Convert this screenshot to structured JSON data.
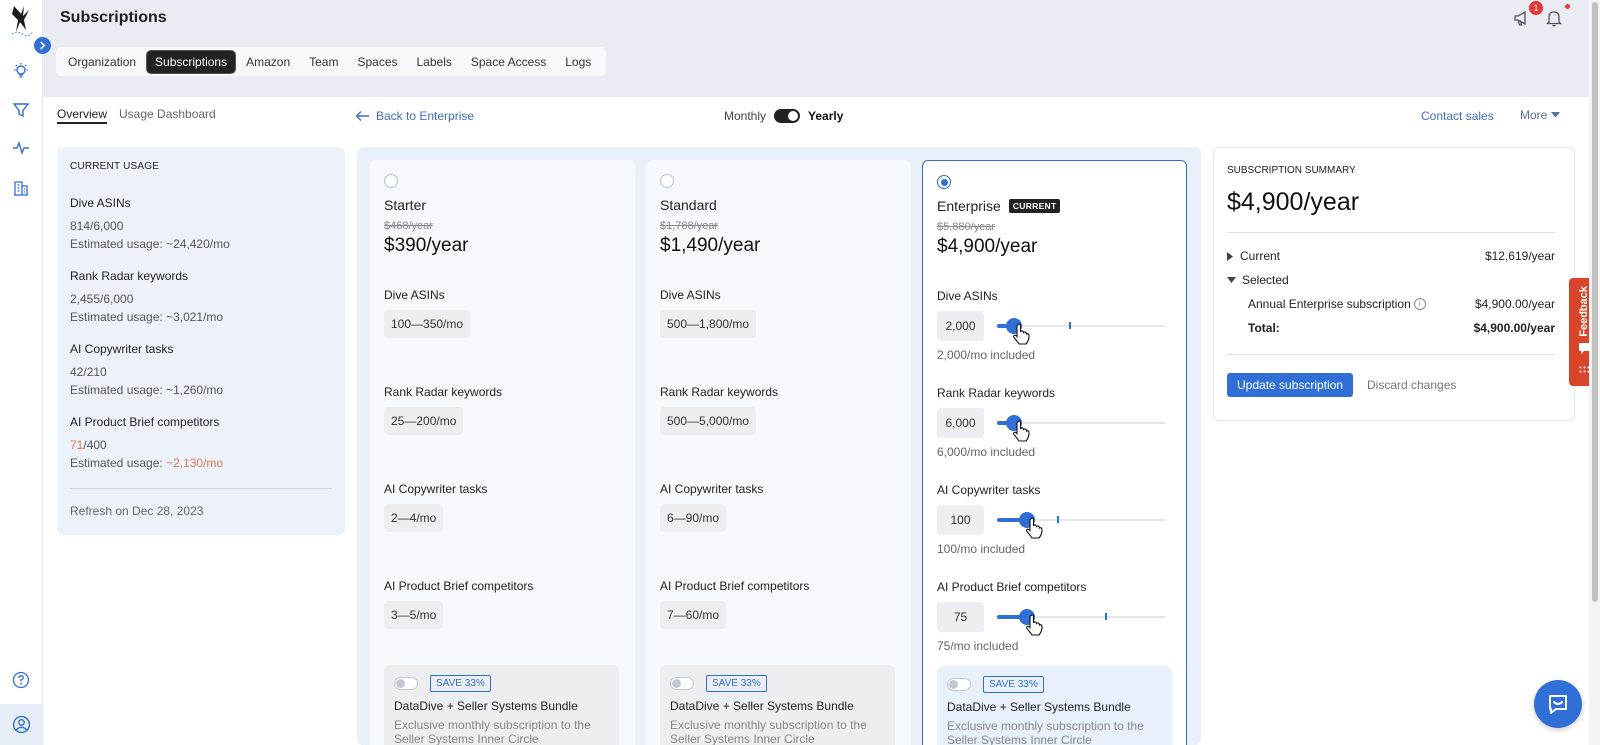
{
  "header": {
    "title": "Subscriptions",
    "notification_count": "1",
    "tabs": [
      "Organization",
      "Subscriptions",
      "Amazon",
      "Team",
      "Spaces",
      "Labels",
      "Space Access",
      "Logs"
    ]
  },
  "subnav": {
    "overview": "Overview",
    "usage_dashboard": "Usage Dashboard",
    "back": "Back to Enterprise",
    "monthly": "Monthly",
    "yearly": "Yearly",
    "contact_sales": "Contact sales",
    "more": "More"
  },
  "usage": {
    "heading": "CURRENT USAGE",
    "items": [
      {
        "title": "Dive ASINs",
        "used": "814",
        "limit": "/6,000",
        "estimate_prefix": "Estimated usage: ",
        "estimate": "~24,420/mo"
      },
      {
        "title": "Rank Radar keywords",
        "used": "2,455",
        "limit": "/6,000",
        "estimate_prefix": "Estimated usage: ",
        "estimate": "~3,021/mo"
      },
      {
        "title": "AI Copywriter tasks",
        "used": "42",
        "limit": "/210",
        "estimate_prefix": "Estimated usage: ",
        "estimate": "~1,260/mo"
      },
      {
        "title": "AI Product Brief competitors",
        "used": "71",
        "limit": "/400",
        "estimate_prefix": "Estimated usage: ",
        "estimate": "~2,130/mo"
      }
    ],
    "refresh": "Refresh on Dec 28, 2023"
  },
  "plans": [
    {
      "name": "Starter",
      "old_price": "$468/year",
      "price": "$390/year",
      "features": [
        {
          "label": "Dive ASINs",
          "range": "100—350/mo"
        },
        {
          "label": "Rank Radar keywords",
          "range": "25—200/mo"
        },
        {
          "label": "AI Copywriter tasks",
          "range": "2—4/mo"
        },
        {
          "label": "AI Product Brief competitors",
          "range": "3—5/mo"
        }
      ]
    },
    {
      "name": "Standard",
      "old_price": "$1,788/year",
      "price": "$1,490/year",
      "features": [
        {
          "label": "Dive ASINs",
          "range": "500—1,800/mo"
        },
        {
          "label": "Rank Radar keywords",
          "range": "500—5,000/mo"
        },
        {
          "label": "AI Copywriter tasks",
          "range": "6—90/mo"
        },
        {
          "label": "AI Product Brief competitors",
          "range": "7—60/mo"
        }
      ]
    },
    {
      "name": "Enterprise",
      "badge": "CURRENT",
      "old_price": "$5,880/year",
      "price": "$4,900/year",
      "features": [
        {
          "label": "Dive ASINs",
          "value": "2,000",
          "included": "2,000/mo included",
          "level": 0.1,
          "marker": 0.43
        },
        {
          "label": "Rank Radar keywords",
          "value": "6,000",
          "included": "6,000/mo included",
          "level": 0.1
        },
        {
          "label": "AI Copywriter tasks",
          "value": "100",
          "included": "100/mo included",
          "level": 0.18,
          "marker": 0.36
        },
        {
          "label": "AI Product Brief competitors",
          "value": "75",
          "included": "75/mo included",
          "level": 0.18,
          "marker": 0.64
        }
      ]
    }
  ],
  "bundle": {
    "save": "SAVE 33%",
    "title": "DataDive + Seller Systems Bundle",
    "desc": "Exclusive monthly subscription to the Seller Systems Inner Circle"
  },
  "summary": {
    "heading": "SUBSCRIPTION SUMMARY",
    "price": "$4,900/year",
    "current_label": "Current",
    "current_value": "$12,619/year",
    "selected_label": "Selected",
    "line_label": "Annual Enterprise subscription",
    "line_value": "$4,900.00/year",
    "total_label": "Total:",
    "total_value": "$4,900.00/year",
    "update": "Update subscription",
    "discard": "Discard changes"
  },
  "feedback": "Feedback",
  "colors": {
    "accent": "#2f6fd6",
    "warning": "#e07b53",
    "feedback": "#d9452b"
  }
}
